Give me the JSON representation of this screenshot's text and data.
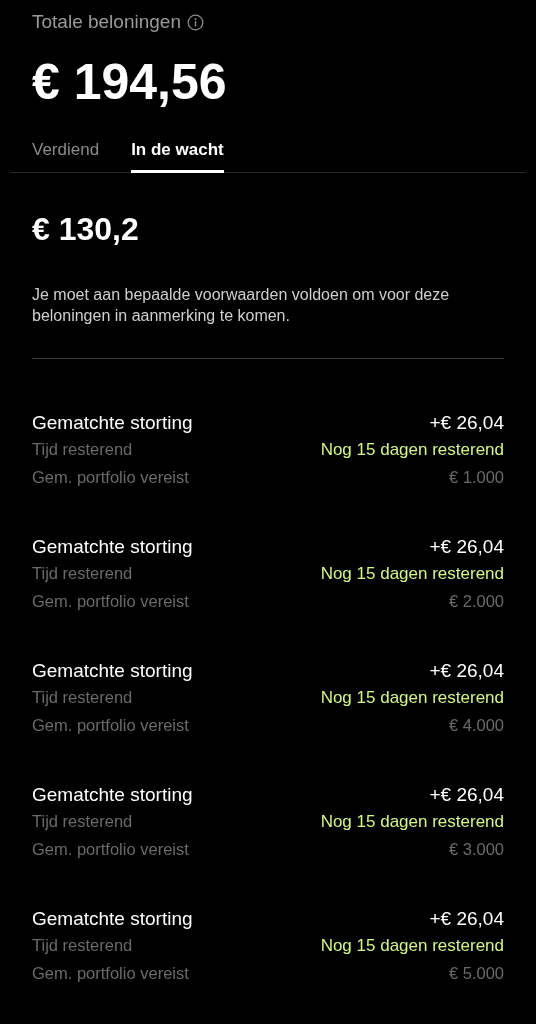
{
  "header": {
    "title": "Totale beloningen",
    "total": "€ 194,56"
  },
  "tabs": [
    {
      "label": "Verdiend",
      "selected": false
    },
    {
      "label": "In de wacht",
      "selected": true
    }
  ],
  "pending": {
    "amount": "€ 130,2",
    "note": "Je moet aan bepaalde voorwaarden voldoen om voor deze beloningen in aanmerking te komen."
  },
  "rewards": [
    {
      "title": "Gematchte storting",
      "amount": "+€ 26,04",
      "time_label": "Tijd resterend",
      "time_value": "Nog 15 dagen resterend",
      "portfolio_label": "Gem. portfolio vereist",
      "portfolio_value": "€ 1.000"
    },
    {
      "title": "Gematchte storting",
      "amount": "+€ 26,04",
      "time_label": "Tijd resterend",
      "time_value": "Nog 15 dagen resterend",
      "portfolio_label": "Gem. portfolio vereist",
      "portfolio_value": "€ 2.000"
    },
    {
      "title": "Gematchte storting",
      "amount": "+€ 26,04",
      "time_label": "Tijd resterend",
      "time_value": "Nog 15 dagen resterend",
      "portfolio_label": "Gem. portfolio vereist",
      "portfolio_value": "€ 4.000"
    },
    {
      "title": "Gematchte storting",
      "amount": "+€ 26,04",
      "time_label": "Tijd resterend",
      "time_value": "Nog 15 dagen resterend",
      "portfolio_label": "Gem. portfolio vereist",
      "portfolio_value": "€ 3.000"
    },
    {
      "title": "Gematchte storting",
      "amount": "+€ 26,04",
      "time_label": "Tijd resterend",
      "time_value": "Nog 15 dagen resterend",
      "portfolio_label": "Gem. portfolio vereist",
      "portfolio_value": "€ 5.000"
    }
  ]
}
